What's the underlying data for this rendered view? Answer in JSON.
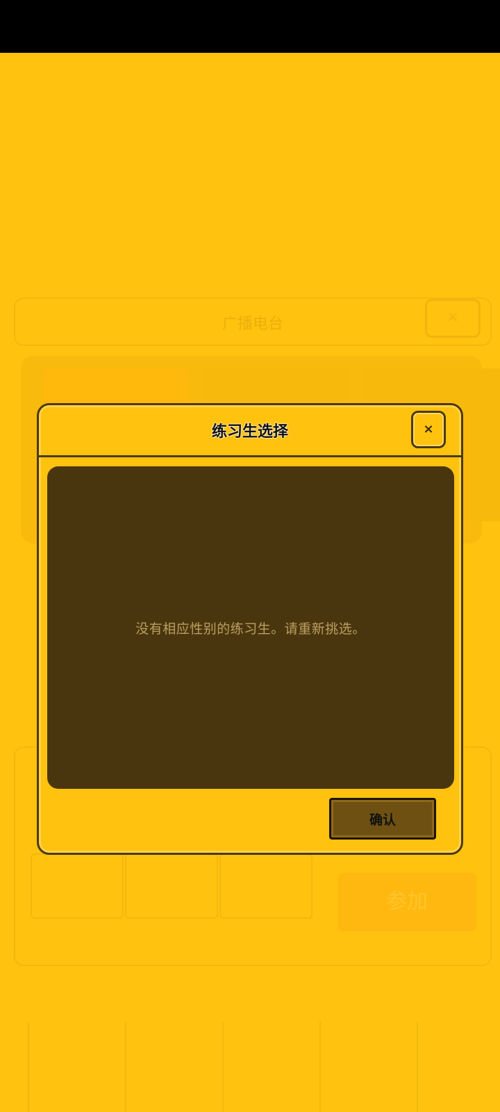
{
  "background": {
    "title": "广播电台",
    "close_label": "×",
    "join_label": "参加"
  },
  "dialog": {
    "title": "练习生选择",
    "close_label": "×",
    "message": "没有相应性别的练习生。请重新挑选。",
    "confirm_label": "确认"
  },
  "colors": {
    "overlay": "#FFC20E",
    "message_bg": "#4A360E",
    "message_text": "#BC9E61",
    "confirm_bg": "#6E5112"
  }
}
